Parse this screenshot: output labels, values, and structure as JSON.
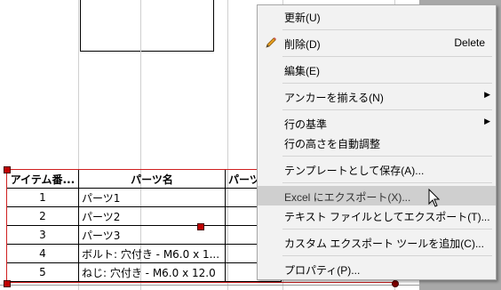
{
  "table": {
    "headers": [
      "アイテム番...",
      "パーツ名",
      "パーツ"
    ],
    "rows": [
      {
        "item": "1",
        "name": "パーツ1"
      },
      {
        "item": "2",
        "name": "パーツ2"
      },
      {
        "item": "3",
        "name": "パーツ3"
      },
      {
        "item": "4",
        "name": "ボルト: 穴付き - M6.0 x 1..."
      },
      {
        "item": "5",
        "name": "ねじ: 穴付き - M6.0 x 12.0"
      }
    ]
  },
  "context_menu": {
    "items": [
      {
        "label": "更新(U)"
      },
      {
        "label": "削除(D)",
        "shortcut": "Delete",
        "icon": "pencil-icon"
      },
      {
        "label": "編集(E)"
      },
      {
        "label": "アンカーを揃える(N)",
        "submenu": true
      },
      {
        "label": "行の基準",
        "submenu": true
      },
      {
        "label": "行の高さを自動調整"
      },
      {
        "label": "テンプレートとして保存(A)..."
      },
      {
        "label": "Excel にエクスポート(X)...",
        "highlighted": true
      },
      {
        "label": "テキスト ファイルとしてエクスポート(T)..."
      },
      {
        "label": "カスタム エクスポート ツールを追加(C)..."
      },
      {
        "label": "プロパティ(P)..."
      }
    ]
  }
}
